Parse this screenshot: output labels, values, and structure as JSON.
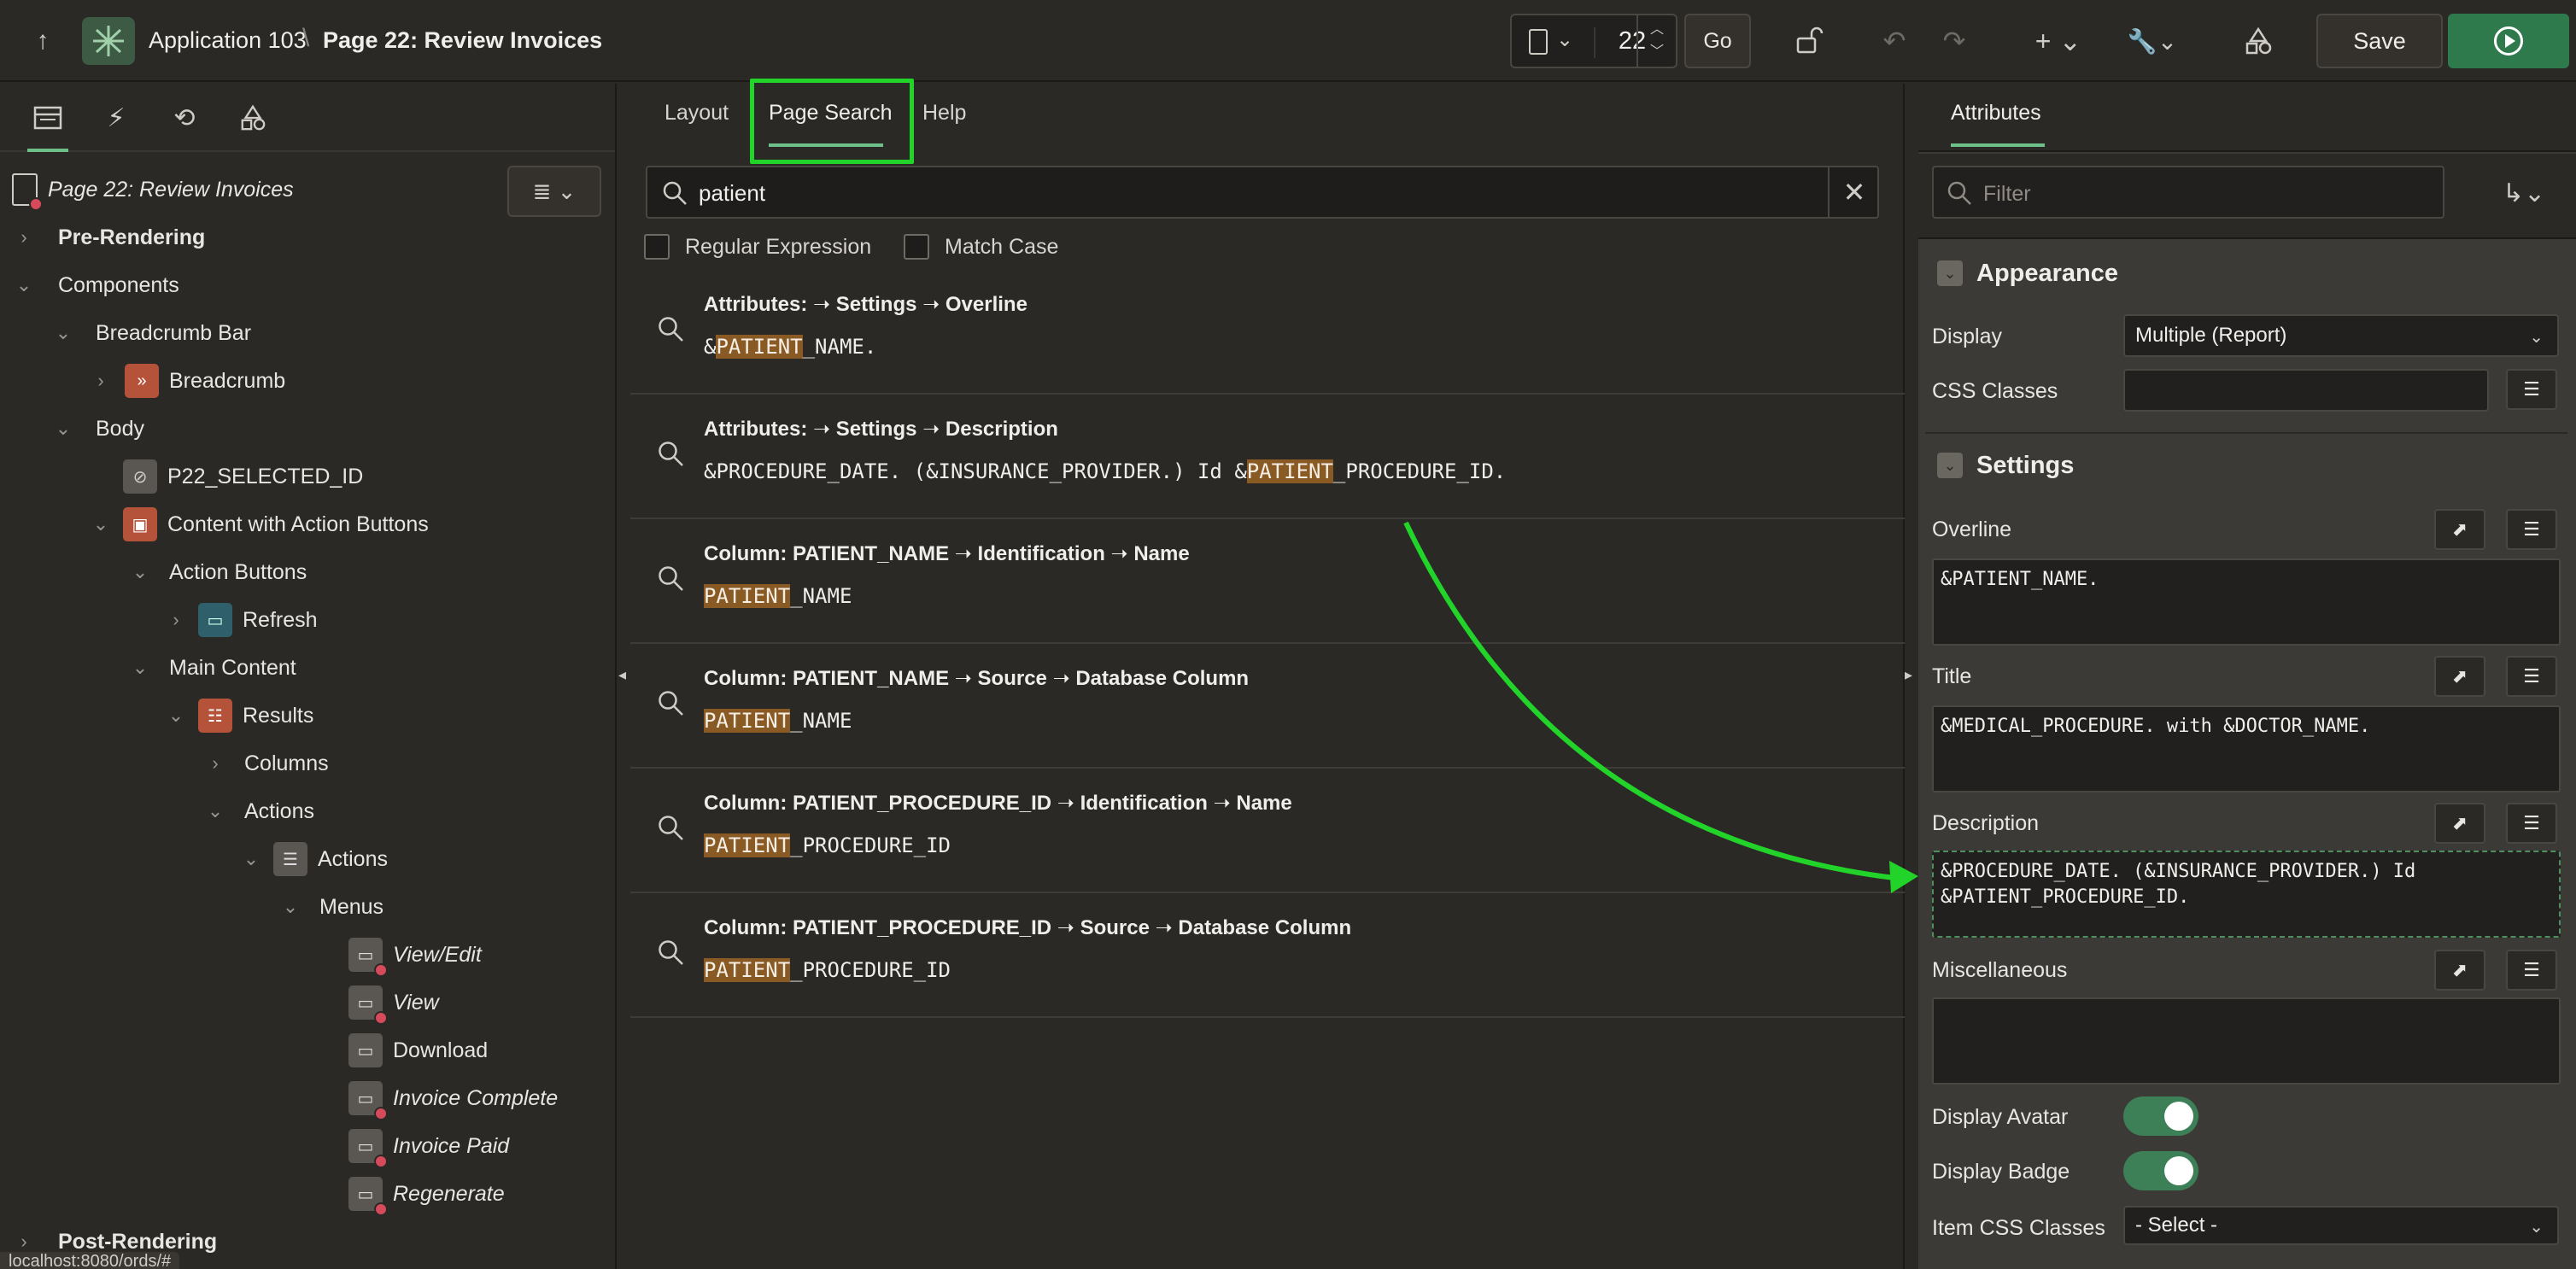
{
  "header": {
    "app_name": "Application 103",
    "separator": "\\",
    "page_name": "Page 22: Review Invoices",
    "page_number": "22",
    "go_label": "Go",
    "save_label": "Save"
  },
  "left": {
    "tree": [
      {
        "label": "Page 22: Review Invoices"
      },
      {
        "label": "Pre-Rendering"
      },
      {
        "label": "Components"
      },
      {
        "label": "Breadcrumb Bar"
      },
      {
        "label": "Breadcrumb"
      },
      {
        "label": "Body"
      },
      {
        "label": "P22_SELECTED_ID"
      },
      {
        "label": "Content with Action Buttons"
      },
      {
        "label": "Action Buttons"
      },
      {
        "label": "Refresh"
      },
      {
        "label": "Main Content"
      },
      {
        "label": "Results"
      },
      {
        "label": "Columns"
      },
      {
        "label": "Actions"
      },
      {
        "label": "Actions"
      },
      {
        "label": "Menus"
      },
      {
        "label": "View/Edit"
      },
      {
        "label": "View"
      },
      {
        "label": "Download"
      },
      {
        "label": "Invoice Complete"
      },
      {
        "label": "Invoice Paid"
      },
      {
        "label": "Regenerate"
      },
      {
        "label": "Post-Rendering"
      }
    ],
    "status_url": "localhost:8080/ords/#"
  },
  "center": {
    "tabs": [
      "Layout",
      "Page Search",
      "Help"
    ],
    "search": {
      "value": "patient"
    },
    "options": {
      "regex_label": "Regular Expression",
      "case_label": "Match Case"
    },
    "results": [
      {
        "title": "Attributes: ➝ Settings ➝ Overline",
        "pre": "&",
        "hl": "PATIENT",
        "post": "_NAME."
      },
      {
        "title": "Attributes: ➝ Settings ➝ Description",
        "pre": "&PROCEDURE_DATE. (&INSURANCE_PROVIDER.) Id &",
        "hl": "PATIENT",
        "post": "_PROCEDURE_ID."
      },
      {
        "title": "Column: PATIENT_NAME ➝ Identification ➝ Name",
        "pre": "",
        "hl": "PATIENT",
        "post": "_NAME"
      },
      {
        "title": "Column: PATIENT_NAME ➝ Source ➝ Database Column",
        "pre": "",
        "hl": "PATIENT",
        "post": "_NAME"
      },
      {
        "title": "Column: PATIENT_PROCEDURE_ID ➝ Identification ➝ Name",
        "pre": "",
        "hl": "PATIENT",
        "post": "_PROCEDURE_ID"
      },
      {
        "title": "Column: PATIENT_PROCEDURE_ID ➝ Source ➝ Database Column",
        "pre": "",
        "hl": "PATIENT",
        "post": "_PROCEDURE_ID"
      }
    ]
  },
  "right": {
    "tab_label": "Attributes",
    "filter_placeholder": "Filter",
    "appearance": {
      "title": "Appearance",
      "display_label": "Display",
      "display_value": "Multiple (Report)",
      "css_label": "CSS Classes"
    },
    "settings": {
      "title": "Settings",
      "overline_label": "Overline",
      "overline_value": "&PATIENT_NAME.",
      "title_label": "Title",
      "title_value": "&MEDICAL_PROCEDURE. with &DOCTOR_NAME.",
      "description_label": "Description",
      "description_value": "&PROCEDURE_DATE. (&INSURANCE_PROVIDER.) Id\n&PATIENT_PROCEDURE_ID.",
      "misc_label": "Miscellaneous",
      "misc_value": "",
      "avatar_label": "Display Avatar",
      "badge_label": "Display Badge",
      "item_css_label": "Item CSS Classes",
      "item_css_value": "- Select -"
    }
  },
  "colors": {
    "accent_green": "#2f7a4c",
    "highlight_box": "#22d429",
    "match_highlight": "#8a5a24"
  }
}
